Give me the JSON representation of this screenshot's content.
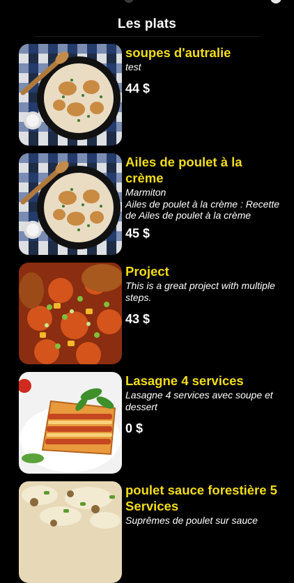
{
  "header": {
    "title": "Les plats"
  },
  "dishes": [
    {
      "name": "soupes d'autralie",
      "description": "test",
      "price": "44 $",
      "image": "creamy-chicken-skillet-photo"
    },
    {
      "name": "Ailes de poulet à la crème",
      "description": "Marmiton\nAiles de poulet à la crème : Recette de Ailes de poulet à la crème",
      "price": "45 $",
      "image": "creamy-chicken-skillet-photo"
    },
    {
      "name": "Project",
      "description": "This is a great project with multiple steps.",
      "price": "43 $",
      "image": "jollof-rice-chicken-photo"
    },
    {
      "name": "Lasagne 4 services",
      "description": "Lasagne 4 services avec soupe et dessert",
      "price": "0 $",
      "image": "lasagna-plate-photo"
    },
    {
      "name": "poulet sauce forestière 5 Services",
      "description": "Suprêmes de poulet sur sauce",
      "price": "",
      "image": "chicken-mushroom-sauce-photo"
    }
  ],
  "colors": {
    "background": "#000000",
    "dish_name": "#f2dd1c",
    "text": "#ffffff"
  }
}
